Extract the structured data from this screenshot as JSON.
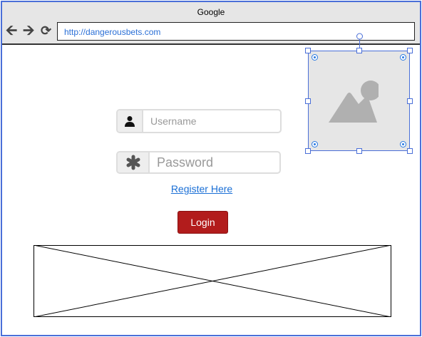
{
  "browser": {
    "title": "Google",
    "url": "http://dangerousbets.com",
    "icons": [
      "arrow-left-icon",
      "arrow-right-icon",
      "refresh-icon"
    ]
  },
  "form": {
    "username_placeholder": "Username",
    "password_placeholder": "Password",
    "register_link": "Register Here",
    "login_button": "Login"
  },
  "colors": {
    "accent": "#b21c1c",
    "link": "#1a6fd6",
    "selection": "#4a6fd8"
  }
}
